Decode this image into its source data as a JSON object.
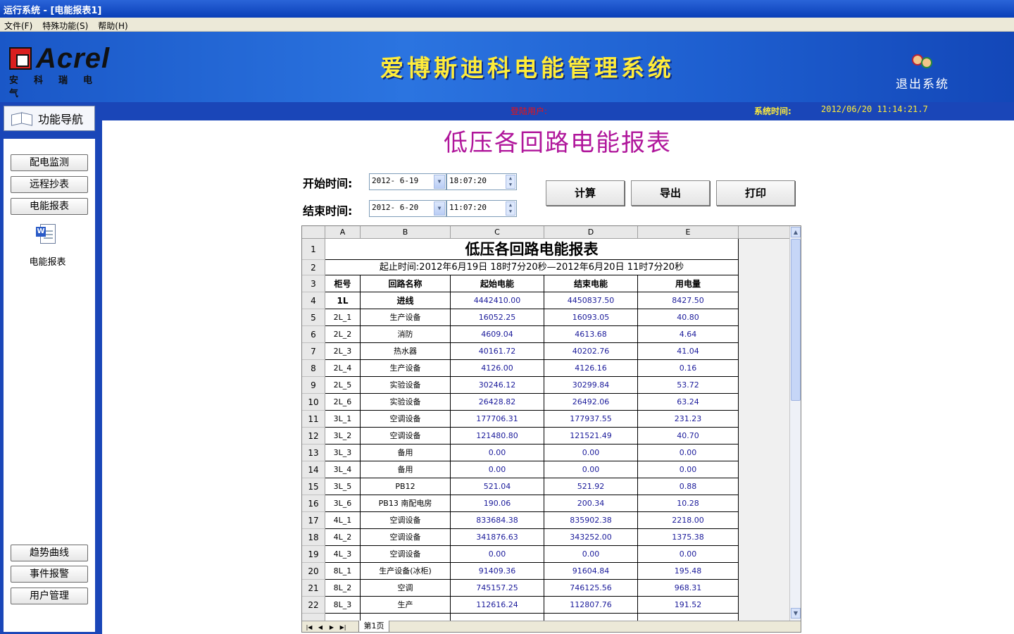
{
  "window": {
    "title": "运行系统 - [电能报表1]"
  },
  "menu": [
    "文件(F)",
    "特殊功能(S)",
    "帮助(H)"
  ],
  "banner": {
    "logo_text": "Acrel",
    "logo_sub": "安科瑞电气",
    "app_title": "爱博斯迪科电能管理系统",
    "exit_label": "退出系统"
  },
  "status": {
    "login_label": "登陆用户:",
    "systime_label": "系统时间:",
    "systime_value": "2012/06/20    11:14:21.7"
  },
  "nav": {
    "header": "功能导航",
    "top_buttons": [
      "配电监测",
      "远程抄表",
      "电能报表"
    ],
    "doc_label": "电能报表",
    "bottom_buttons": [
      "趋势曲线",
      "事件报警",
      "用户管理"
    ]
  },
  "report": {
    "title": "低压各回路电能报表",
    "start_label": "开始时间:",
    "end_label": "结束时间:",
    "start_date": "2012- 6-19",
    "start_time": "18:07:20",
    "end_date": "2012- 6-20",
    "end_time": "11:07:20",
    "buttons": [
      "计算",
      "导出",
      "打印"
    ]
  },
  "sheet": {
    "columns": [
      "A",
      "B",
      "C",
      "D",
      "E"
    ],
    "title_row": "低压各回路电能报表",
    "range_row": "起止时间:2012年6月19日  18时7分20秒—2012年6月20日  11时7分20秒",
    "headers": [
      "柜号",
      "回路名称",
      "起始电能",
      "结束电能",
      "用电量"
    ],
    "rows": [
      [
        "1L",
        "进线",
        "4442410.00",
        "4450837.50",
        "8427.50"
      ],
      [
        "2L_1",
        "生产设备",
        "16052.25",
        "16093.05",
        "40.80"
      ],
      [
        "2L_2",
        "消防",
        "4609.04",
        "4613.68",
        "4.64"
      ],
      [
        "2L_3",
        "热水器",
        "40161.72",
        "40202.76",
        "41.04"
      ],
      [
        "2L_4",
        "生产设备",
        "4126.00",
        "4126.16",
        "0.16"
      ],
      [
        "2L_5",
        "实验设备",
        "30246.12",
        "30299.84",
        "53.72"
      ],
      [
        "2L_6",
        "实验设备",
        "26428.82",
        "26492.06",
        "63.24"
      ],
      [
        "3L_1",
        "空调设备",
        "177706.31",
        "177937.55",
        "231.23"
      ],
      [
        "3L_2",
        "空调设备",
        "121480.80",
        "121521.49",
        "40.70"
      ],
      [
        "3L_3",
        "备用",
        "0.00",
        "0.00",
        "0.00"
      ],
      [
        "3L_4",
        "备用",
        "0.00",
        "0.00",
        "0.00"
      ],
      [
        "3L_5",
        "PB12",
        "521.04",
        "521.92",
        "0.88"
      ],
      [
        "3L_6",
        "PB13 南配电房",
        "190.06",
        "200.34",
        "10.28"
      ],
      [
        "4L_1",
        "空调设备",
        "833684.38",
        "835902.38",
        "2218.00"
      ],
      [
        "4L_2",
        "空调设备",
        "341876.63",
        "343252.00",
        "1375.38"
      ],
      [
        "4L_3",
        "空调设备",
        "0.00",
        "0.00",
        "0.00"
      ],
      [
        "8L_1",
        "生产设备(冰柜)",
        "91409.36",
        "91604.84",
        "195.48"
      ],
      [
        "8L_2",
        "空调",
        "745157.25",
        "746125.56",
        "968.31"
      ],
      [
        "8L_3",
        "生产",
        "112616.24",
        "112807.76",
        "191.52"
      ]
    ],
    "row_numbers": [
      "1",
      "2",
      "3",
      "4",
      "5",
      "6",
      "7",
      "8",
      "9",
      "10",
      "11",
      "12",
      "13",
      "14",
      "15",
      "16",
      "17",
      "18",
      "19",
      "20",
      "21",
      "22"
    ],
    "tab": "第1页"
  }
}
